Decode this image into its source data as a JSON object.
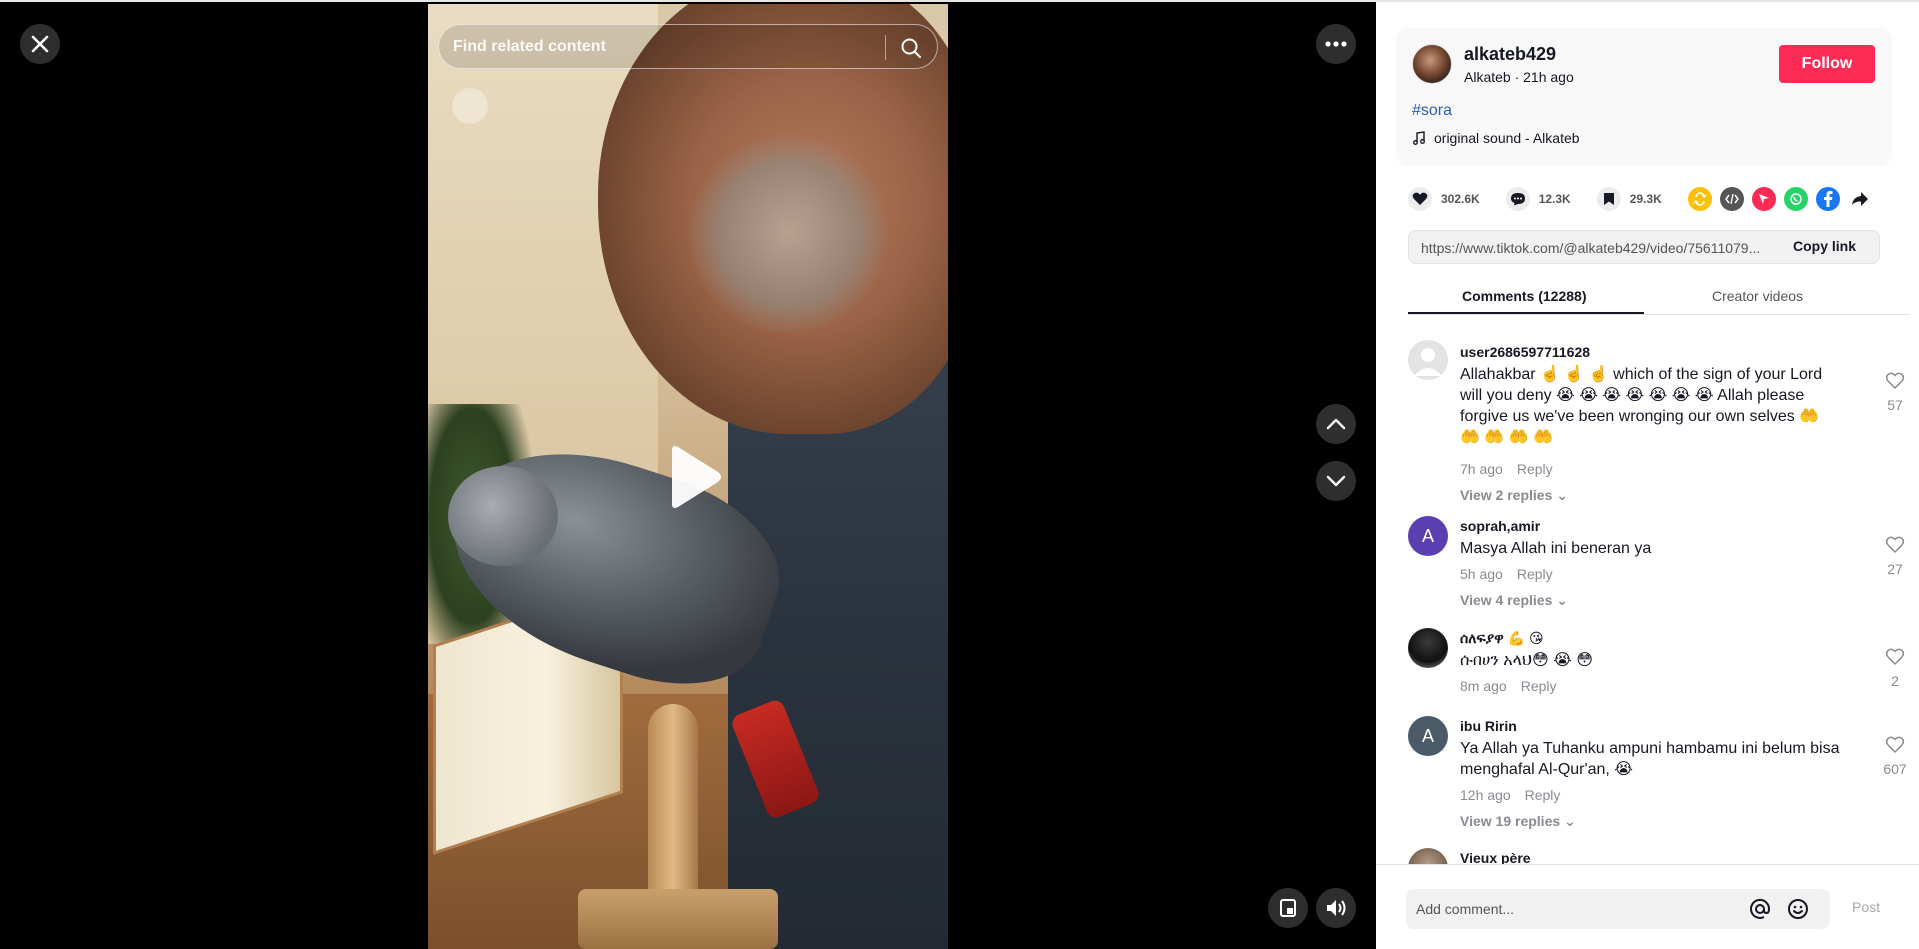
{
  "video": {
    "search_placeholder": "Find related content"
  },
  "author": {
    "username": "alkateb429",
    "subline": "Alkateb · 21h ago",
    "follow_label": "Follow",
    "hashtag": "#sora",
    "music": "original sound - Alkateb"
  },
  "stats": {
    "likes": "302.6K",
    "comments": "12.3K",
    "saves": "29.3K"
  },
  "share_icons": [
    "repost-icon",
    "embed-icon",
    "send-icon",
    "whatsapp-icon",
    "facebook-icon",
    "share-arrow-icon"
  ],
  "colors": {
    "accent": "#fe2c55",
    "hashtag": "#2b5db9",
    "repost": "#ffc107",
    "embed": "#555555",
    "send": "#fe2c55",
    "whatsapp": "#25d366",
    "facebook": "#1877f2"
  },
  "link": {
    "url": "https://www.tiktok.com/@alkateb429/video/75611079...",
    "copy_label": "Copy link"
  },
  "tabs": {
    "comments": "Comments (12288)",
    "creator": "Creator videos"
  },
  "comments": [
    {
      "user": "user2686597711628",
      "text": "Allahakbar ☝️ ☝️ ☝️ which of the sign of your Lord will you deny 😭 😭 😭 😭 😭 😭 😭 Allah please forgive us we've been wronging our own selves 🤲 🤲 🤲 🤲 🤲",
      "time": "7h ago",
      "reply": "Reply",
      "view": "View 2 replies",
      "likes": "57"
    },
    {
      "user": "soprah,amir",
      "avatar_letter": "A",
      "text": "Masya Allah ini beneran ya",
      "time": "5h ago",
      "reply": "Reply",
      "view": "View 4 replies",
      "likes": "27"
    },
    {
      "user": "ሰለፍያዋ 💪 😘",
      "text": "ሱበሀን አላህ😳 😭 😳",
      "time": "8m ago",
      "reply": "Reply",
      "likes": "2"
    },
    {
      "user": "ibu Ririn",
      "avatar_letter": "A",
      "text": "Ya Allah ya Tuhanku ampuni hambamu ini belum bisa menghafal Al-Qur'an, 😭",
      "time": "12h ago",
      "reply": "Reply",
      "view": "View 19 replies",
      "likes": "607"
    },
    {
      "user": "Vieux père"
    }
  ],
  "composer": {
    "placeholder": "Add comment...",
    "post_label": "Post"
  }
}
